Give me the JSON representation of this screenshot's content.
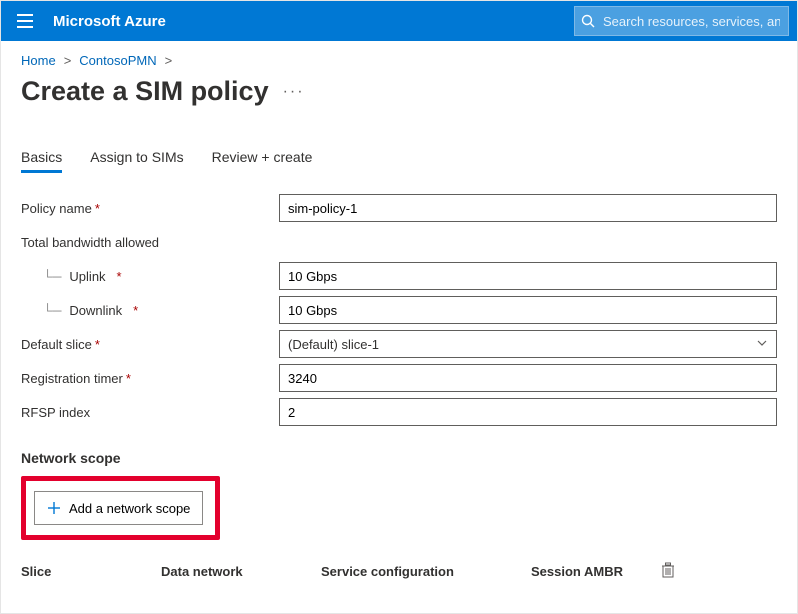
{
  "brand": "Microsoft Azure",
  "search": {
    "placeholder": "Search resources, services, and docs"
  },
  "breadcrumb": {
    "items": [
      {
        "label": "Home"
      },
      {
        "label": "ContosoPMN"
      }
    ],
    "sep": ">"
  },
  "page": {
    "title": "Create a SIM policy"
  },
  "tabs": {
    "t0": "Basics",
    "t1": "Assign to SIMs",
    "t2": "Review + create"
  },
  "form": {
    "policy_name_label": "Policy name",
    "policy_name_value": "sim-policy-1",
    "bandwidth_label": "Total bandwidth allowed",
    "uplink_label": "Uplink",
    "uplink_value": "10 Gbps",
    "downlink_label": "Downlink",
    "downlink_value": "10 Gbps",
    "default_slice_label": "Default slice",
    "default_slice_value": "(Default) slice-1",
    "reg_timer_label": "Registration timer",
    "reg_timer_value": "3240",
    "rfsp_label": "RFSP index",
    "rfsp_value": "2"
  },
  "scope": {
    "section_title": "Network scope",
    "add_label": "Add a network scope",
    "cols": {
      "slice": "Slice",
      "data_network": "Data network",
      "service_config": "Service configuration",
      "session_ambr": "Session AMBR"
    }
  },
  "colors": {
    "accent": "#0078d4",
    "highlight": "#e3002d"
  }
}
